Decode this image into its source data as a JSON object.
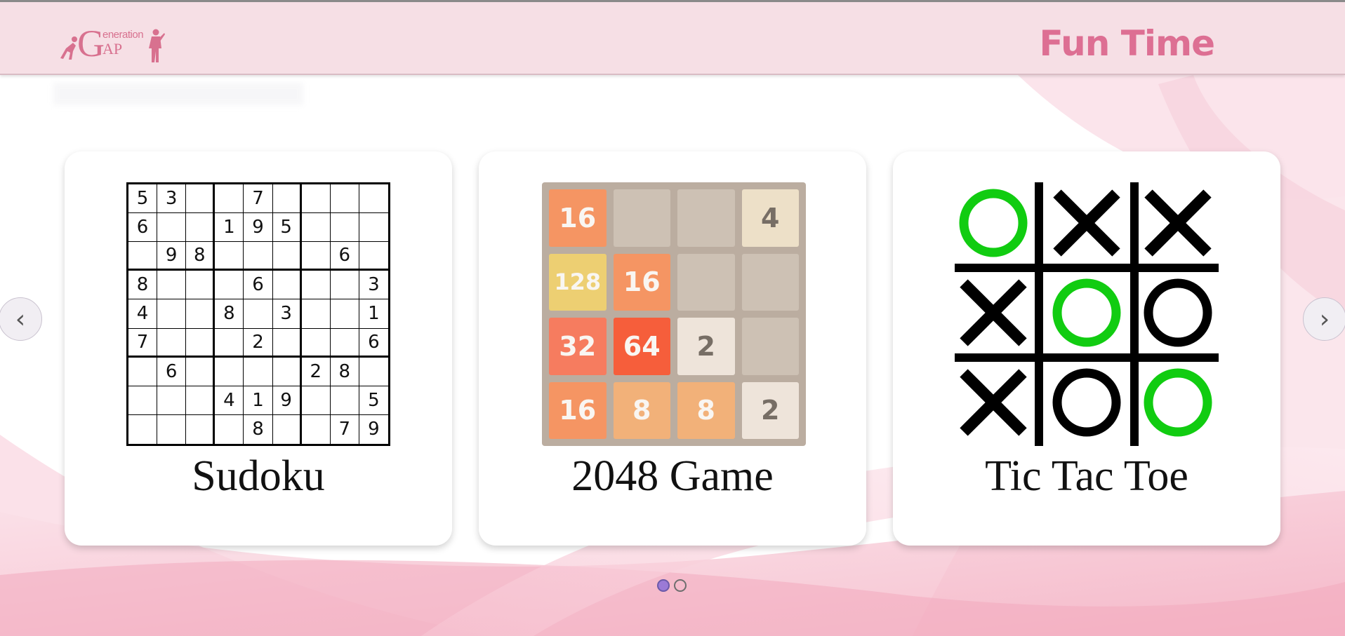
{
  "header": {
    "logo": {
      "big": "G",
      "line1": "eneration",
      "line2": "AP"
    },
    "title": "Fun Time"
  },
  "carousel": {
    "cards": [
      {
        "title": "Sudoku",
        "icon": "sudoku-board-image"
      },
      {
        "title": "2048 Game",
        "icon": "2048-board-image"
      },
      {
        "title": "Tic Tac Toe",
        "icon": "tic-tac-toe-board-image"
      }
    ],
    "prev_label": "‹",
    "next_label": "›",
    "pages": 2,
    "active_page": 1
  },
  "sudoku": [
    [
      "5",
      "3",
      "",
      "",
      "7",
      "",
      "",
      "",
      ""
    ],
    [
      "6",
      "",
      "",
      "1",
      "9",
      "5",
      "",
      "",
      ""
    ],
    [
      "",
      "9",
      "8",
      "",
      "",
      "",
      "",
      "6",
      ""
    ],
    [
      "8",
      "",
      "",
      "",
      "6",
      "",
      "",
      "",
      "3"
    ],
    [
      "4",
      "",
      "",
      "8",
      "",
      "3",
      "",
      "",
      "1"
    ],
    [
      "7",
      "",
      "",
      "",
      "2",
      "",
      "",
      "",
      "6"
    ],
    [
      "",
      "6",
      "",
      "",
      "",
      "",
      "2",
      "8",
      ""
    ],
    [
      "",
      "",
      "",
      "4",
      "1",
      "9",
      "",
      "",
      "5"
    ],
    [
      "",
      "",
      "",
      "",
      "8",
      "",
      "",
      "7",
      "9"
    ]
  ],
  "game2048": [
    [
      "16",
      "",
      "",
      "4"
    ],
    [
      "128",
      "16",
      "",
      ""
    ],
    [
      "32",
      "64",
      "2",
      ""
    ],
    [
      "16",
      "8",
      "8",
      "2"
    ]
  ],
  "tictactoe": [
    [
      "O-green",
      "X",
      "X"
    ],
    [
      "X",
      "O-green",
      "O"
    ],
    [
      "X",
      "O",
      "O-green"
    ]
  ],
  "colors": {
    "accent": "#dd6f93",
    "header_bg": "#f6dfe5",
    "dot_active": "#9b7ad6",
    "ttt_green": "#11cc11"
  }
}
